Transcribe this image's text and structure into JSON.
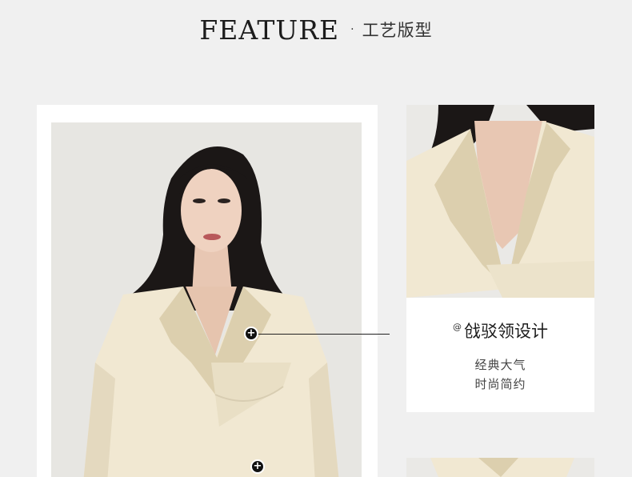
{
  "header": {
    "title_en": "FEATURE",
    "separator": "·",
    "title_cn": "工艺版型"
  },
  "hotspots": [
    {
      "symbol": "+"
    },
    {
      "symbol": "+"
    }
  ],
  "detail": {
    "title_prefix": "@",
    "title": "戗驳领设计",
    "desc_line1": "经典大气",
    "desc_line2": "时尚简约"
  },
  "colors": {
    "background": "#f0f0f0",
    "card": "#ffffff",
    "garment": "#f1e8d2",
    "satin_lapel": "#dccfae",
    "hair": "#1b1716"
  }
}
